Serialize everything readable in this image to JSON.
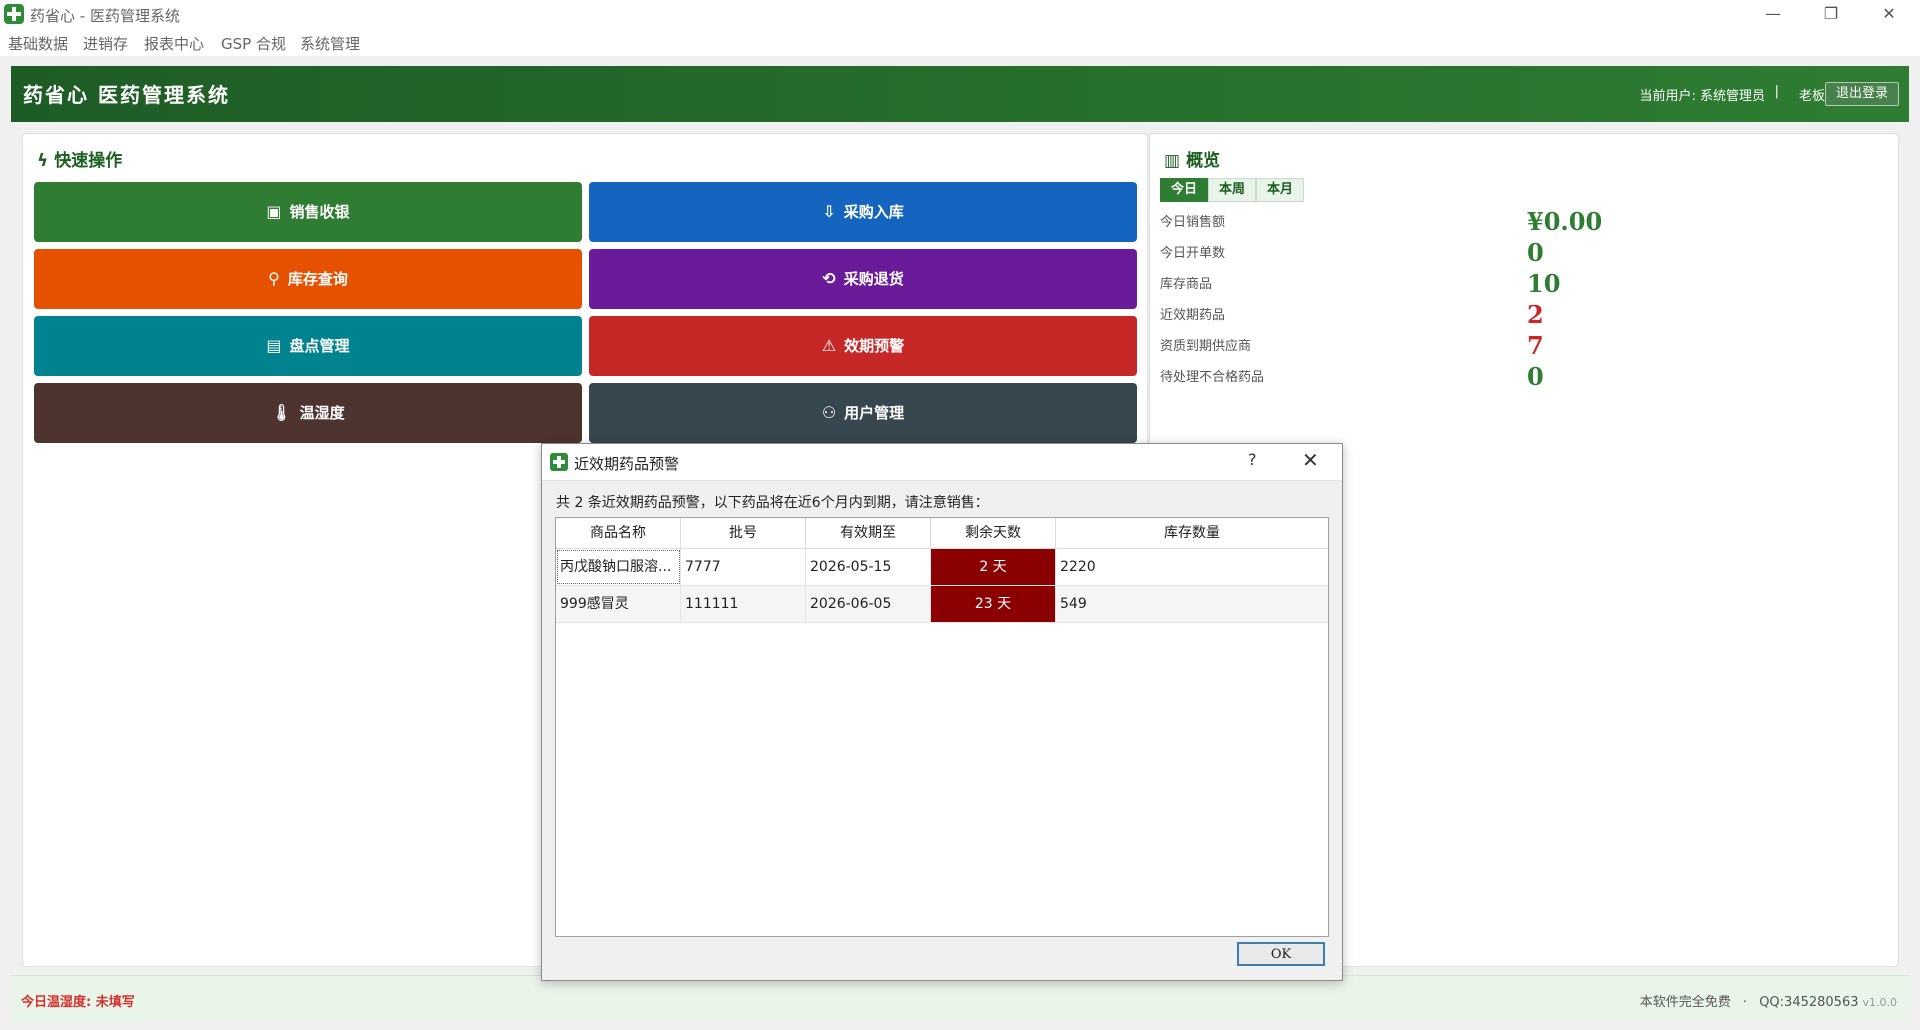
{
  "window": {
    "title": "药省心 - 医药管理系统",
    "minimize": "—",
    "restore": "❐",
    "close": "✕"
  },
  "menu": [
    "基础数据",
    "进销存",
    "报表中心",
    "GSP 合规",
    "系统管理"
  ],
  "header": {
    "title": "药省心  医药管理系统",
    "user_label": "当前用户: 系统管理员",
    "separator": "|",
    "role": "老板",
    "logout": "退出登录"
  },
  "quick": {
    "title": "快速操作",
    "title_icon": "bolt-icon",
    "buttons": [
      {
        "label": "销售收银",
        "icon": "receipt-icon",
        "color": "#2e7d32"
      },
      {
        "label": "采购入库",
        "icon": "inbox-icon",
        "color": "#1565c0"
      },
      {
        "label": "库存查询",
        "icon": "search-icon",
        "color": "#e65100"
      },
      {
        "label": "采购退货",
        "icon": "return-icon",
        "color": "#6a1b9a"
      },
      {
        "label": "盘点管理",
        "icon": "clipboard-icon",
        "color": "#00838f"
      },
      {
        "label": "效期预警",
        "icon": "warning-icon",
        "color": "#c62828"
      },
      {
        "label": "温湿度",
        "icon": "thermometer-icon",
        "color": "#4e342e"
      },
      {
        "label": "用户管理",
        "icon": "users-icon",
        "color": "#37474f"
      }
    ]
  },
  "overview": {
    "title": "概览",
    "title_icon": "chart-icon",
    "tabs": [
      "今日",
      "本周",
      "本月"
    ],
    "active_tab": 0,
    "stats": [
      {
        "label": "今日销售额",
        "value": "¥0.00",
        "color": "#2e7d32"
      },
      {
        "label": "今日开单数",
        "value": "0",
        "color": "#2e7d32"
      },
      {
        "label": "库存商品",
        "value": "10",
        "color": "#2e7d32"
      },
      {
        "label": "近效期药品",
        "value": "2",
        "color": "#c62828"
      },
      {
        "label": "资质到期供应商",
        "value": "7",
        "color": "#c62828"
      },
      {
        "label": "待处理不合格药品",
        "value": "0",
        "color": "#2e7d32"
      }
    ]
  },
  "footer": {
    "humidity": "今日温湿度: 未填写",
    "free": "本软件完全免费",
    "dot": "·",
    "qq": "QQ:345280563",
    "version": "v1.0.0"
  },
  "dialog": {
    "title": "近效期药品预警",
    "help": "?",
    "close": "✕",
    "message": "共 2 条近效期药品预警，以下药品将在近6个月内到期，请注意销售：",
    "columns": [
      "商品名称",
      "批号",
      "有效期至",
      "剩余天数",
      "库存数量"
    ],
    "rows": [
      {
        "name": "丙戊酸钠口服溶...",
        "batch": "7777",
        "expiry": "2026-05-15",
        "days": "2 天",
        "qty": "2220"
      },
      {
        "name": "999感冒灵",
        "batch": "111111",
        "expiry": "2026-06-05",
        "days": "23 天",
        "qty": "549"
      }
    ],
    "ok": "OK"
  }
}
